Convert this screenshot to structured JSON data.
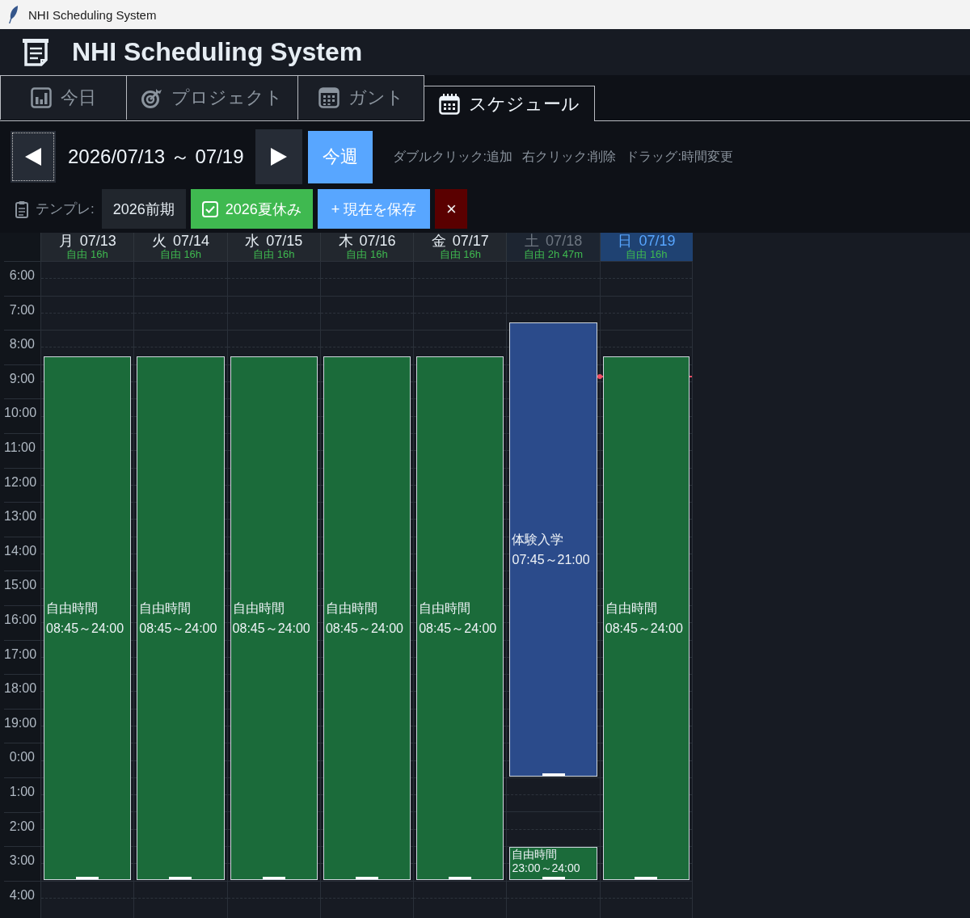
{
  "title_bar": {
    "title": "NHI Scheduling System"
  },
  "header": {
    "title": "NHI Scheduling System"
  },
  "tabs": [
    {
      "label": "今日",
      "selected": false
    },
    {
      "label": "プロジェクト",
      "selected": false
    },
    {
      "label": "ガント",
      "selected": false
    },
    {
      "label": "スケジュール",
      "selected": true
    }
  ],
  "week_nav": {
    "range": "2026/07/13 ～ 07/19",
    "this_week_button": "今週",
    "hints": [
      "ダブルクリック:追加",
      "右クリック:削除",
      "ドラッグ:時間変更"
    ]
  },
  "templates": {
    "label": "テンプレ:",
    "items": [
      {
        "label": "2026前期",
        "selected": false
      },
      {
        "label": "2026夏休み",
        "selected": true
      }
    ],
    "save_button": "+ 現在を保存",
    "delete_button": "×"
  },
  "schedule": {
    "current_time": {
      "level": 0.8133
    },
    "hours": [
      "6:00",
      "7:00",
      "8:00",
      "9:00",
      "10:00",
      "11:00",
      "12:00",
      "13:00",
      "14:00",
      "15:00",
      "16:00",
      "17:00",
      "18:00",
      "19:00",
      "0:00",
      "1:00",
      "2:00",
      "3:00",
      "4:00"
    ],
    "days": [
      {
        "label": "月 07/13",
        "free": "自由 16h",
        "kind": "weekday",
        "events": [
          {
            "kind": "free",
            "title": "自由時間",
            "time": "08:45～24:00"
          }
        ]
      },
      {
        "label": "火 07/14",
        "free": "自由 16h",
        "kind": "weekday",
        "events": [
          {
            "kind": "free",
            "title": "自由時間",
            "time": "08:45～24:00"
          }
        ]
      },
      {
        "label": "水 07/15",
        "free": "自由 16h",
        "kind": "weekday",
        "events": [
          {
            "kind": "free",
            "title": "自由時間",
            "time": "08:45～24:00"
          }
        ]
      },
      {
        "label": "木 07/16",
        "free": "自由 16h",
        "kind": "weekday",
        "events": [
          {
            "kind": "free",
            "title": "自由時間",
            "time": "08:45～24:00"
          }
        ]
      },
      {
        "label": "金 07/17",
        "free": "自由 16h",
        "kind": "weekday",
        "events": [
          {
            "kind": "free",
            "title": "自由時間",
            "time": "08:45～24:00"
          }
        ]
      },
      {
        "label": "土 07/18",
        "free": "自由 2h 47m",
        "kind": "weekend",
        "events": [
          {
            "kind": "event",
            "title": "体験入学",
            "time": "07:45～21:00"
          },
          {
            "kind": "free",
            "title": "自由時間",
            "time": "23:00～24:00"
          }
        ]
      },
      {
        "label": "日 07/19",
        "free": "自由 16h",
        "kind": "today",
        "events": [
          {
            "kind": "free",
            "title": "自由時間",
            "time": "08:45～24:00"
          }
        ]
      }
    ]
  }
}
